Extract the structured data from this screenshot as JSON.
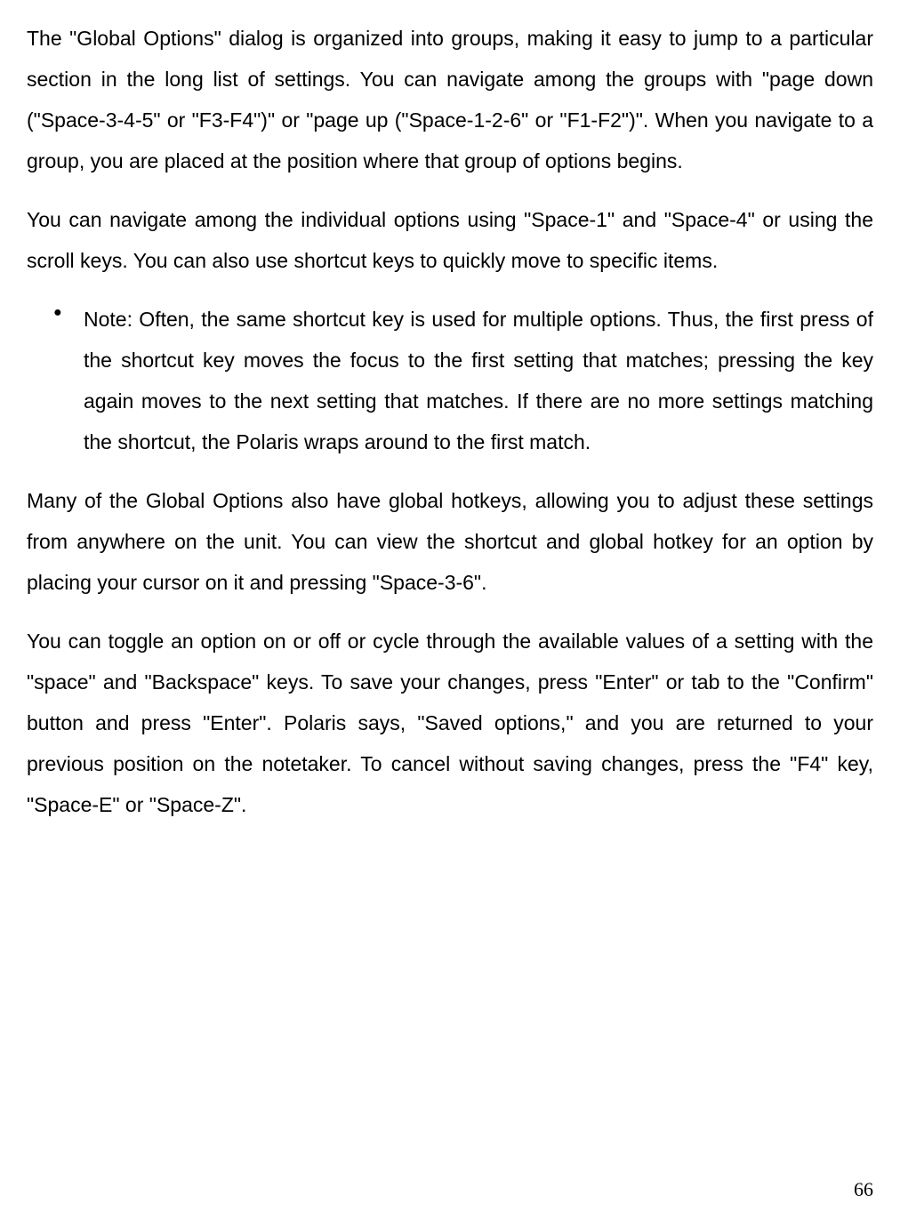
{
  "paragraphs": {
    "p1": "The \"Global Options\" dialog is organized into groups, making it easy to jump to a particular section in the long list of settings. You can navigate among the groups with \"page down (\"Space-3-4-5\" or \"F3-F4\")\" or \"page up (\"Space-1-2-6\" or \"F1-F2\")\". When you navigate to a group, you are placed at the position where that group of options begins.",
    "p2": "You can navigate among the individual options using \"Space-1\" and \"Space-4\" or using the scroll keys. You can also use shortcut keys to quickly move to specific items.",
    "p3": "Many of the Global Options also have global hotkeys, allowing you to adjust these settings from anywhere on the unit. You can view the shortcut and global hotkey for an option by placing your cursor on it and pressing \"Space-3-6\".",
    "p4": "You can toggle an option on or off or cycle through the available values of a setting with the \"space\" and \"Backspace\" keys. To save your changes, press \"Enter\" or tab to the \"Confirm\" button and press \"Enter\". Polaris says, \"Saved options,\" and you are returned to your previous position on the notetaker. To cancel without saving changes, press the \"F4\" key, \"Space-E\" or \"Space-Z\"."
  },
  "bullets": {
    "b1": "Note: Often, the same shortcut key is used for multiple options. Thus, the first press of the shortcut key moves the focus to the first setting that matches; pressing the key again moves to the next setting that matches. If there are no more settings matching the shortcut, the Polaris wraps around to the first match."
  },
  "page_number": "66"
}
